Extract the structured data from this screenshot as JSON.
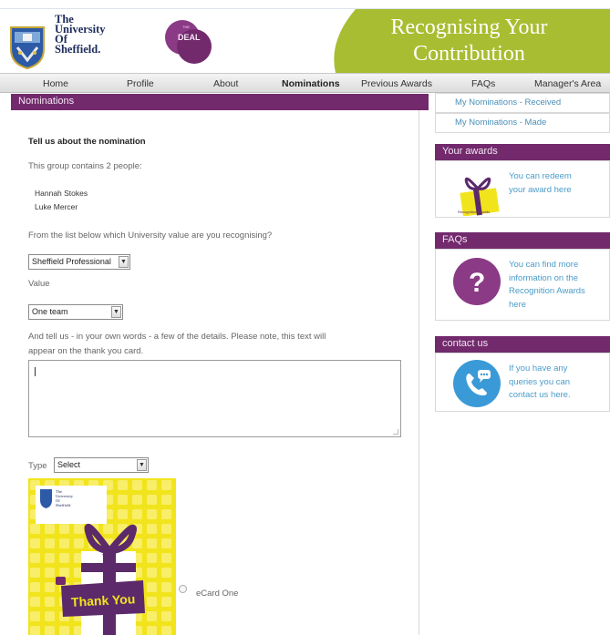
{
  "header": {
    "university_lines": [
      "The",
      "University",
      "Of",
      "Sheffield."
    ],
    "deal_badge": "DEAL",
    "banner_lines": [
      "Recognising Your",
      "Contribution"
    ],
    "colors": {
      "banner": "#a8bd31",
      "purple": "#722a6d",
      "link": "#4a9cc9"
    }
  },
  "nav": {
    "items": [
      "Home",
      "Profile",
      "About",
      "Nominations",
      "Previous Awards",
      "FAQs",
      "Manager's Area"
    ],
    "active": "Nominations"
  },
  "main": {
    "section_title": "Nominations",
    "heading": "Tell us about the nomination",
    "group_text": "This group contains 2 people:",
    "people": [
      "Hannah Stokes",
      "Luke Mercer"
    ],
    "value_question": "From the list below which University value are you recognising?",
    "value_group_select": "Sheffield Professional",
    "value_label": "Value",
    "value_select": "One team",
    "details_text_line1": "And tell us - in your own words - a few of the details. Please note, this text will",
    "details_text_line2": "appear on the thank you card.",
    "details_value": "",
    "type_label": "Type",
    "type_select": "Select",
    "card": {
      "logo_lines": [
        "The",
        "University",
        "Of",
        "Sheffield"
      ],
      "thank_you": "Thank You",
      "option_label": "eCard One"
    }
  },
  "sidebar": {
    "links": [
      "My Nominations - Received",
      "My Nominations - Made"
    ],
    "awards": {
      "title": "Your awards",
      "text_lines": [
        "You can redeem",
        "your award here"
      ],
      "image_caption": "Recognition Awards"
    },
    "faqs": {
      "title": "FAQs",
      "text_lines": [
        "You can find more",
        "information on the",
        "Recognition Awards",
        "here"
      ],
      "icon_glyph": "?"
    },
    "contact": {
      "title": "contact us",
      "text_lines": [
        "If you have any",
        "queries you can",
        "contact us here."
      ]
    }
  }
}
